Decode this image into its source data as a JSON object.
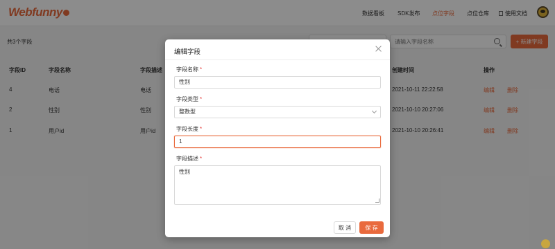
{
  "header": {
    "logo_text": "Webfunny",
    "nav": [
      "数据看板",
      "SDK发布",
      "点位字段",
      "点位仓库",
      "使用文档"
    ],
    "active_nav": "点位字段",
    "accent_color": "#e96a3d"
  },
  "toolbar": {
    "count_label": "共3个字段",
    "search_placeholder": "请输入字段名称",
    "new_button_label": "+ 新建字段"
  },
  "table": {
    "columns": [
      "字段ID",
      "字段名称",
      "字段描述",
      "创建时间",
      "操作"
    ],
    "rows": [
      {
        "id": "4",
        "name": "电话",
        "desc": "电话",
        "created": "2021-10-11 22:22:58"
      },
      {
        "id": "2",
        "name": "性别",
        "desc": "性别",
        "created": "2021-10-10 20:27:06"
      },
      {
        "id": "1",
        "name": "用户id",
        "desc": "用户id",
        "created": "2021-10-10 20:26:41"
      }
    ],
    "edit_label": "编辑",
    "delete_label": "删除"
  },
  "modal": {
    "title": "编辑字段",
    "required_mark": "*",
    "fields": {
      "name": {
        "label": "字段名称",
        "value": "性别"
      },
      "type": {
        "label": "字段类型",
        "value": "整数型"
      },
      "length": {
        "label": "字段长度",
        "value": "1"
      },
      "desc": {
        "label": "字段描述",
        "value": "性别"
      }
    },
    "cancel_label": "取 消",
    "save_label": "保 存"
  }
}
